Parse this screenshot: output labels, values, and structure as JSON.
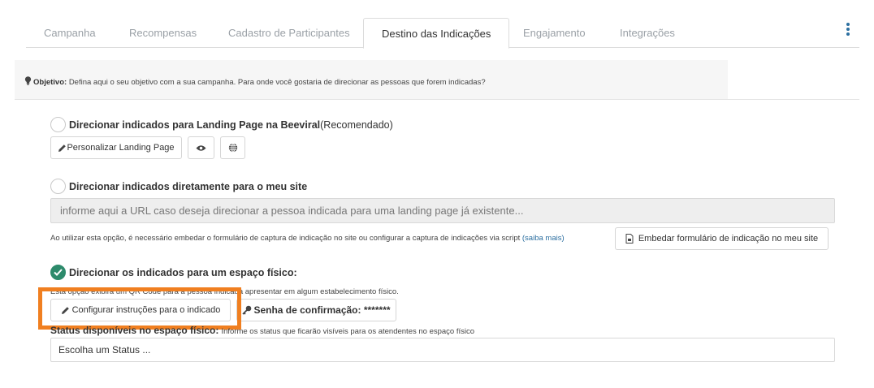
{
  "tabs": [
    {
      "label": "Campanha"
    },
    {
      "label": "Recompensas"
    },
    {
      "label": "Cadastro de Participantes"
    },
    {
      "label": "Destino das Indicações",
      "active": true
    },
    {
      "label": "Engajamento"
    },
    {
      "label": "Integrações"
    }
  ],
  "menu_icon": "kebab-vertical-icon",
  "objective": {
    "icon": "lightbulb-icon",
    "label": "Objetivo:",
    "text": "Defina aqui o seu objetivo com a sua campanha. Para onde você gostaria de direcionar as pessoas que forem indicadas?"
  },
  "option_landing": {
    "selected": false,
    "title": "Direcionar indicados para Landing Page na Beeviral",
    "suffix": "(Recomendado)",
    "customize_button": "Personalizar Landing Page",
    "preview_icon": "eye-icon",
    "globe_icon": "globe-icon"
  },
  "option_site": {
    "selected": false,
    "title": "Direcionar indicados diretamente para o meu site",
    "url_placeholder": "informe aqui a URL caso deseja direcionar a pessoa indicada para uma landing page já existente...",
    "note": "Ao utilizar esta opção, é necessário embedar o formulário de captura de indicação no site ou configurar a captura de indicações via script",
    "note_link": "(saiba mais)",
    "embed_button": "Embedar formulário de indicação no meu site"
  },
  "option_physical": {
    "selected": true,
    "title": "Direcionar os indicados para um espaço físico:",
    "description": "Esta opção exibirá um QR Code para a pessoa indicada apresentar em algum estabelecimento físico.",
    "config_button": "Configurar instruções para o indicado",
    "password_label": "Senha de confirmação:",
    "password_value": "*******",
    "status_label": "Status disponíveis no espaço físico:",
    "status_help": "Informe os status que ficarão visíveis para os atendentes no espaço físico",
    "status_placeholder": "Escolha um Status ..."
  },
  "colors": {
    "accent": "#2c6fa0",
    "checked": "#2d8a6b",
    "highlight": "#f07f20"
  }
}
